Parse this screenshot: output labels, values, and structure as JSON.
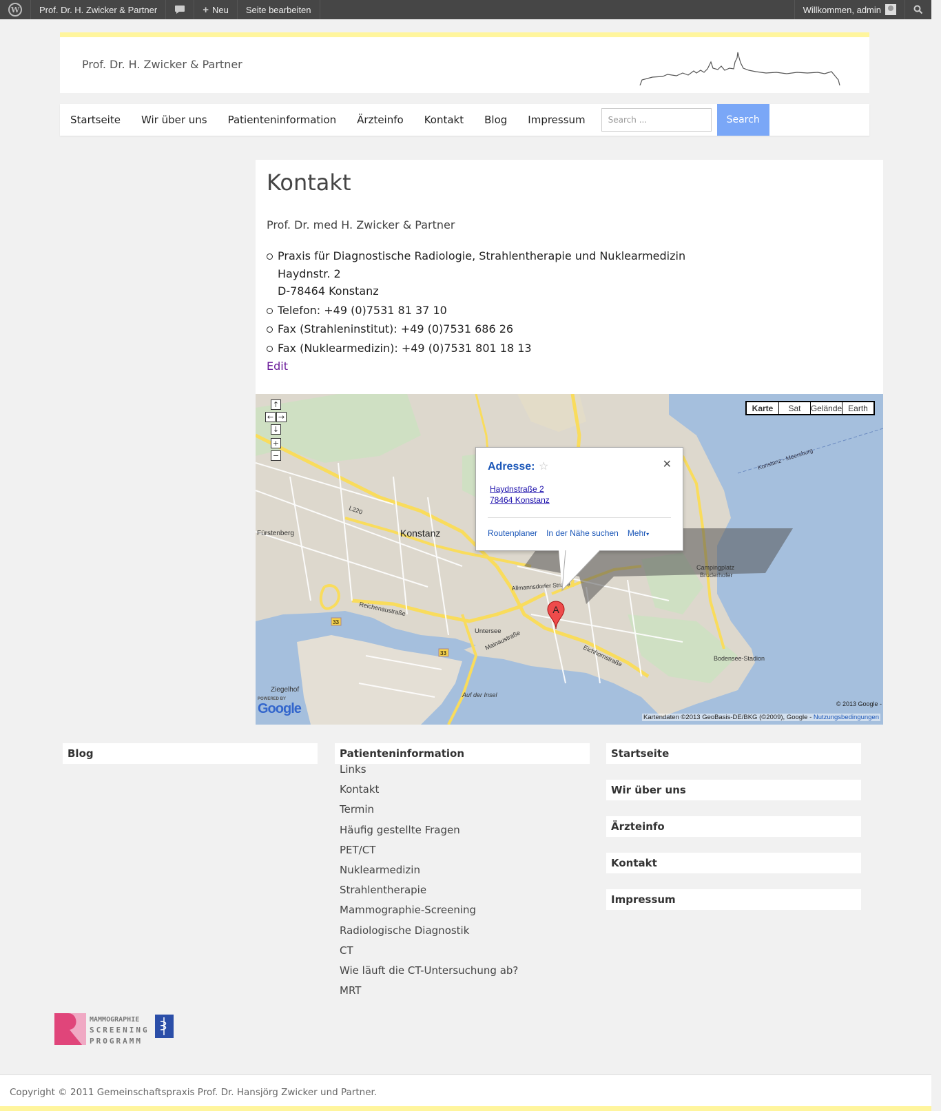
{
  "adminbar": {
    "site_name": "Prof. Dr. H. Zwicker & Partner",
    "new_label": "Neu",
    "edit_page": "Seite bearbeiten",
    "welcome": "Willkommen, admin"
  },
  "header": {
    "site_title": "Prof. Dr. H. Zwicker & Partner"
  },
  "nav": {
    "items": [
      "Startseite",
      "Wir über uns",
      "Patienteninformation",
      "Ärzteinfo",
      "Kontakt",
      "Blog",
      "Impressum"
    ],
    "search_placeholder": "Search ...",
    "search_button": "Search"
  },
  "content": {
    "title": "Kontakt",
    "intro": "Prof. Dr. med H. Zwicker & Partner",
    "address_line1": "Praxis für Diagnostische Radiologie, Strahlentherapie und Nuklearmedizin",
    "address_line2": "Haydnstr. 2",
    "address_line3": "D-78464 Konstanz",
    "phone": "Telefon: +49 (0)7531 81 37 10",
    "fax1": "Fax (Strahleninstitut): +49 (0)7531 686 26",
    "fax2": "Fax (Nuklearmedizin): +49 (0)7531 801 18 13",
    "edit": "Edit"
  },
  "map": {
    "types": [
      "Karte",
      "Sat",
      "Gelände",
      "Earth"
    ],
    "bubble_title": "Adresse:",
    "bubble_street": "Haydnstraße 2",
    "bubble_city": "78464 Konstanz",
    "link_route": "Routenplaner",
    "link_nearby": "In der Nähe suchen",
    "link_more": "Mehr",
    "marker_label": "A",
    "copyright": "© 2013 Google -",
    "attribution": "Kartendaten ©2013 GeoBasis-DE/BKG (©2009), Google -",
    "terms": "Nutzungsbedingungen",
    "powered_by": "POWERED BY",
    "google": "Google",
    "labels": {
      "konstanz": "Konstanz",
      "fuerstenberg": "Fürstenberg",
      "untersee": "Untersee",
      "camping": "Campingplatz",
      "bruderhofer": "Bruderhofer",
      "stadion": "Bodensee-Stadion",
      "ferry": "Konstanz - Meersburg",
      "insel": "Auf der Insel",
      "ziegelhof": "Ziegelhof",
      "reichenau": "Reichenaustraße",
      "mainau": "Mainaustraße",
      "eichhorn": "Eichhornstraße",
      "allmanns": "Allmannsdorfer Straße",
      "l220": "L220",
      "b33": "33"
    }
  },
  "footer_widgets": {
    "blog": "Blog",
    "patient_title": "Patienteninformation",
    "patient_items": [
      "Links",
      "Kontakt",
      "Termin",
      "Häufig gestellte Fragen",
      "PET/CT",
      "Nuklearmedizin",
      "Strahlentherapie",
      "Mammographie-Screening",
      "Radiologische Diagnostik",
      "CT",
      "Wie läuft die CT-Untersuchung ab?",
      "MRT"
    ],
    "pages": [
      "Startseite",
      "Wir über uns",
      "Ärzteinfo",
      "Kontakt",
      "Impressum"
    ]
  },
  "logo": {
    "line1": "MAMMOGRAPHIE",
    "line2": "SCREENING",
    "line3": "PROGRAMM"
  },
  "footer": {
    "copyright": "Copyright © 2011 Gemeinschaftspraxis Prof. Dr. Hansjörg Zwicker und Partner."
  }
}
